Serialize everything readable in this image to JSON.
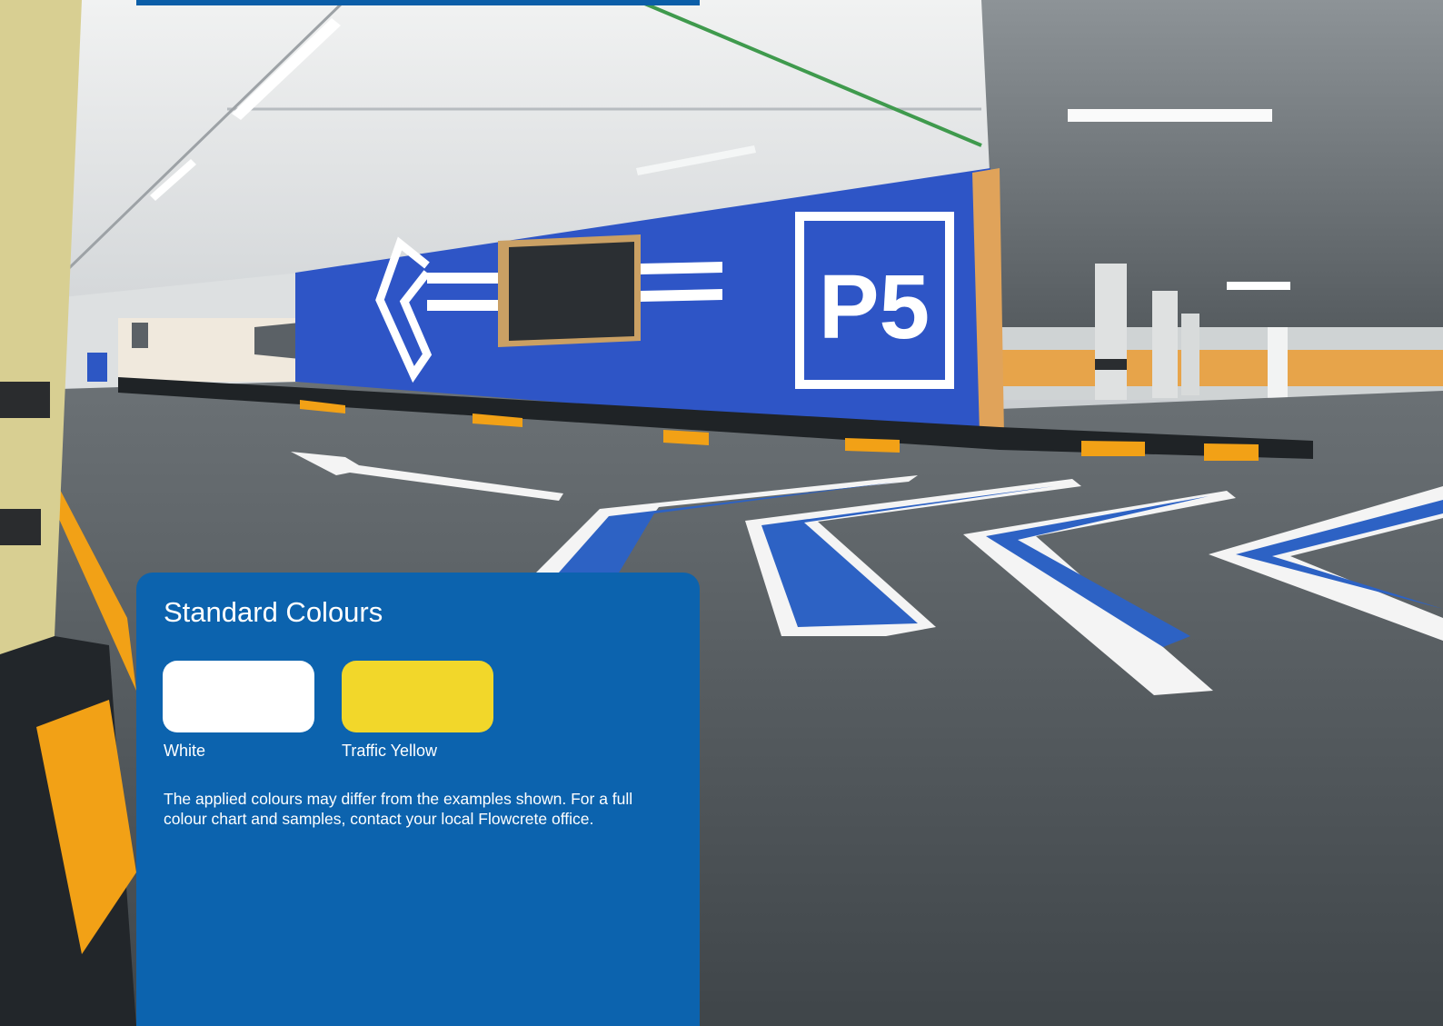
{
  "photo": {
    "sign_text": "P5"
  },
  "colors": {
    "panel_bg": "#0c63ae",
    "wall_blue": "#2e55c6",
    "floor_grey": "#4c5257",
    "kerb_yellow": "#f2a116"
  },
  "panel": {
    "title": "Standard Colours",
    "swatches": [
      {
        "label": "White",
        "color": "#ffffff"
      },
      {
        "label": "Traffic Yellow",
        "color": "#f2d72a"
      }
    ],
    "note": "The applied colours may differ from the examples shown. For a full colour chart and samples, contact your local Flowcrete office."
  }
}
